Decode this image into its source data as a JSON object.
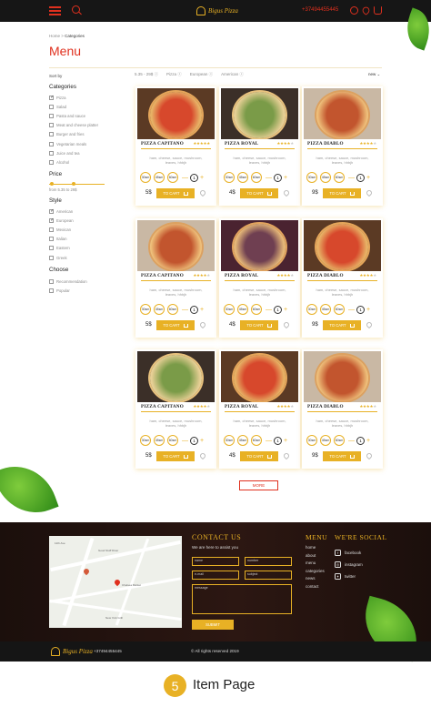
{
  "header": {
    "logo_text": "Bigus Pizza",
    "phone": "+37494455445"
  },
  "breadcrumb": {
    "home": "Home",
    "separator": " > ",
    "current": "Categories"
  },
  "page_title": "Menu",
  "toolbar": {
    "sort_label": "Sort by",
    "filters": [
      "5.35 - 29$",
      "Pizza",
      "European",
      "American"
    ],
    "sort_value": "new"
  },
  "sidebar": {
    "categories_title": "Categories",
    "categories": [
      {
        "label": "Pizza",
        "checked": true
      },
      {
        "label": "Salad",
        "checked": false
      },
      {
        "label": "Pasta and sauce",
        "checked": false
      },
      {
        "label": "Meat and cheese platter",
        "checked": false
      },
      {
        "label": "Burger and fries",
        "checked": false
      },
      {
        "label": "Vegetarian meals",
        "checked": false
      },
      {
        "label": "Juice and tea",
        "checked": false
      },
      {
        "label": "Alcohol",
        "checked": false
      }
    ],
    "price_title": "Price",
    "price_range": "from 5.35 to 29$",
    "price_low": 0.05,
    "price_high": 0.45,
    "style_title": "Style",
    "styles": [
      {
        "label": "American",
        "checked": true
      },
      {
        "label": "European",
        "checked": true
      },
      {
        "label": "Mexican",
        "checked": false
      },
      {
        "label": "Italian",
        "checked": false
      },
      {
        "label": "Eastern",
        "checked": false
      },
      {
        "label": "Greek",
        "checked": false
      }
    ],
    "choose_title": "Choose",
    "choose": [
      {
        "label": "Recommendation",
        "checked": false
      },
      {
        "label": "Popular",
        "checked": false
      }
    ]
  },
  "card_common": {
    "description": "ham, cheese, sauce, mushroom, leaves, hhbjh",
    "sizes": [
      "30sm",
      "45sm",
      "60sm"
    ],
    "qty_minus": "—",
    "qty_value": "1",
    "qty_plus": "+",
    "to_cart": "TO CART"
  },
  "cards": [
    {
      "name": "PIZZA CAPITANO",
      "rating": 5,
      "price": "5$",
      "theme": "red"
    },
    {
      "name": "PIZZA ROYAL",
      "rating": 4,
      "price": "4$",
      "theme": "green"
    },
    {
      "name": "PIZZA DIABLO",
      "rating": 4,
      "price": "9$",
      "theme": "salami"
    },
    {
      "name": "PIZZA CAPITANO",
      "rating": 4,
      "price": "5$",
      "theme": "salami"
    },
    {
      "name": "PIZZA ROYAL",
      "rating": 4,
      "price": "4$",
      "theme": "purple"
    },
    {
      "name": "PIZZA DIABLO",
      "rating": 4,
      "price": "9$",
      "theme": "red"
    },
    {
      "name": "PIZZA CAPITANO",
      "rating": 4,
      "price": "5$",
      "theme": "green"
    },
    {
      "name": "PIZZA ROYAL",
      "rating": 4,
      "price": "4$",
      "theme": "red"
    },
    {
      "name": "PIZZA DIABLO",
      "rating": 4,
      "price": "9$",
      "theme": "salami"
    }
  ],
  "more_label": "MORE",
  "footer": {
    "contact_title": "CONTACT US",
    "contact_sub": "We are here to assist you",
    "fields": {
      "name": "name",
      "number": "number",
      "email": "e-mail",
      "subject": "subject",
      "message": "message"
    },
    "submit": "SUBMIT",
    "menu_title": "MENU",
    "menu_items": [
      "home",
      "about",
      "menu",
      "categories",
      "news",
      "contact"
    ],
    "social_title": "WE'RE SOCIAL",
    "social": [
      {
        "label": "facebook",
        "icon": "facebook-icon",
        "glyph": "f"
      },
      {
        "label": "instagram",
        "icon": "instagram-icon",
        "glyph": "◎"
      },
      {
        "label": "twitter",
        "icon": "twitter-icon",
        "glyph": "✦"
      }
    ],
    "phone": "+37494455445",
    "copyright": "© All rights reserved 2019",
    "map_labels": [
      "12th Ave",
      "Good Stuff Diner",
      "Chelsea Market",
      "New York Grill"
    ]
  },
  "caption": {
    "number": "5",
    "text": "Item Page"
  },
  "colors": {
    "accent": "#e8b125",
    "brand_red": "#e0301e",
    "dark": "#161616"
  }
}
